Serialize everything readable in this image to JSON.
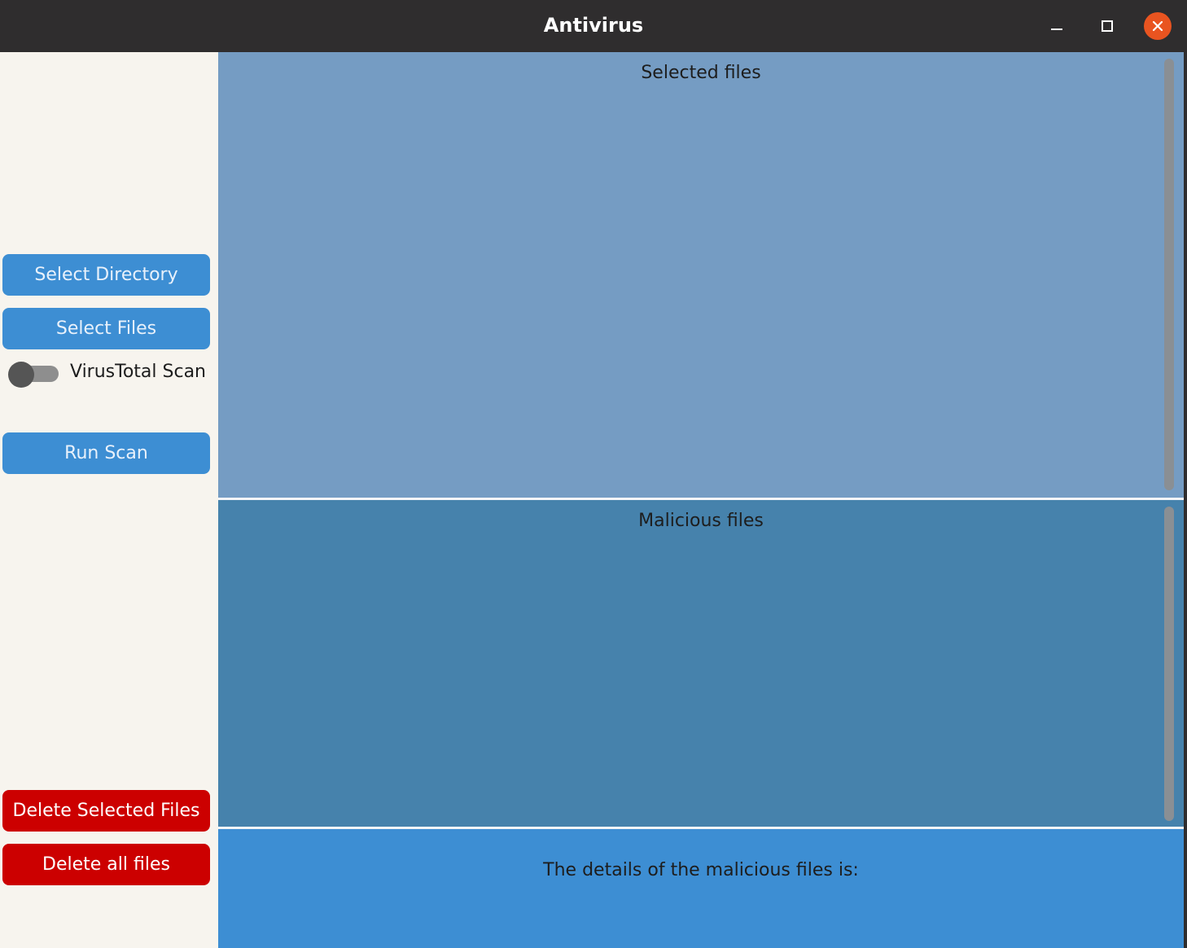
{
  "window": {
    "title": "Antivirus"
  },
  "titlebar": {
    "minimize_icon": "minimize-icon",
    "maximize_icon": "maximize-icon",
    "close_icon": "close-icon",
    "close_color": "#e95420"
  },
  "sidebar": {
    "select_directory_label": "Select Directory",
    "select_files_label": "Select Files",
    "virustotal_toggle": {
      "label": "VirusTotal Scan",
      "state": "off"
    },
    "run_scan_label": "Run Scan",
    "delete_selected_label": "Delete Selected Files",
    "delete_all_label": "Delete all files"
  },
  "panels": {
    "selected_title": "Selected files",
    "malicious_title": "Malicious files",
    "details_text": "The details of the malicious files is:"
  },
  "colors": {
    "button_blue": "#3d8ed3",
    "button_red": "#cc0000",
    "selected_panel_bg": "#759cc3",
    "malicious_panel_bg": "#4682ac",
    "details_panel_bg": "#3d8ed3",
    "sidebar_bg": "#f7f4ee",
    "titlebar_bg": "#2f2d2e"
  }
}
